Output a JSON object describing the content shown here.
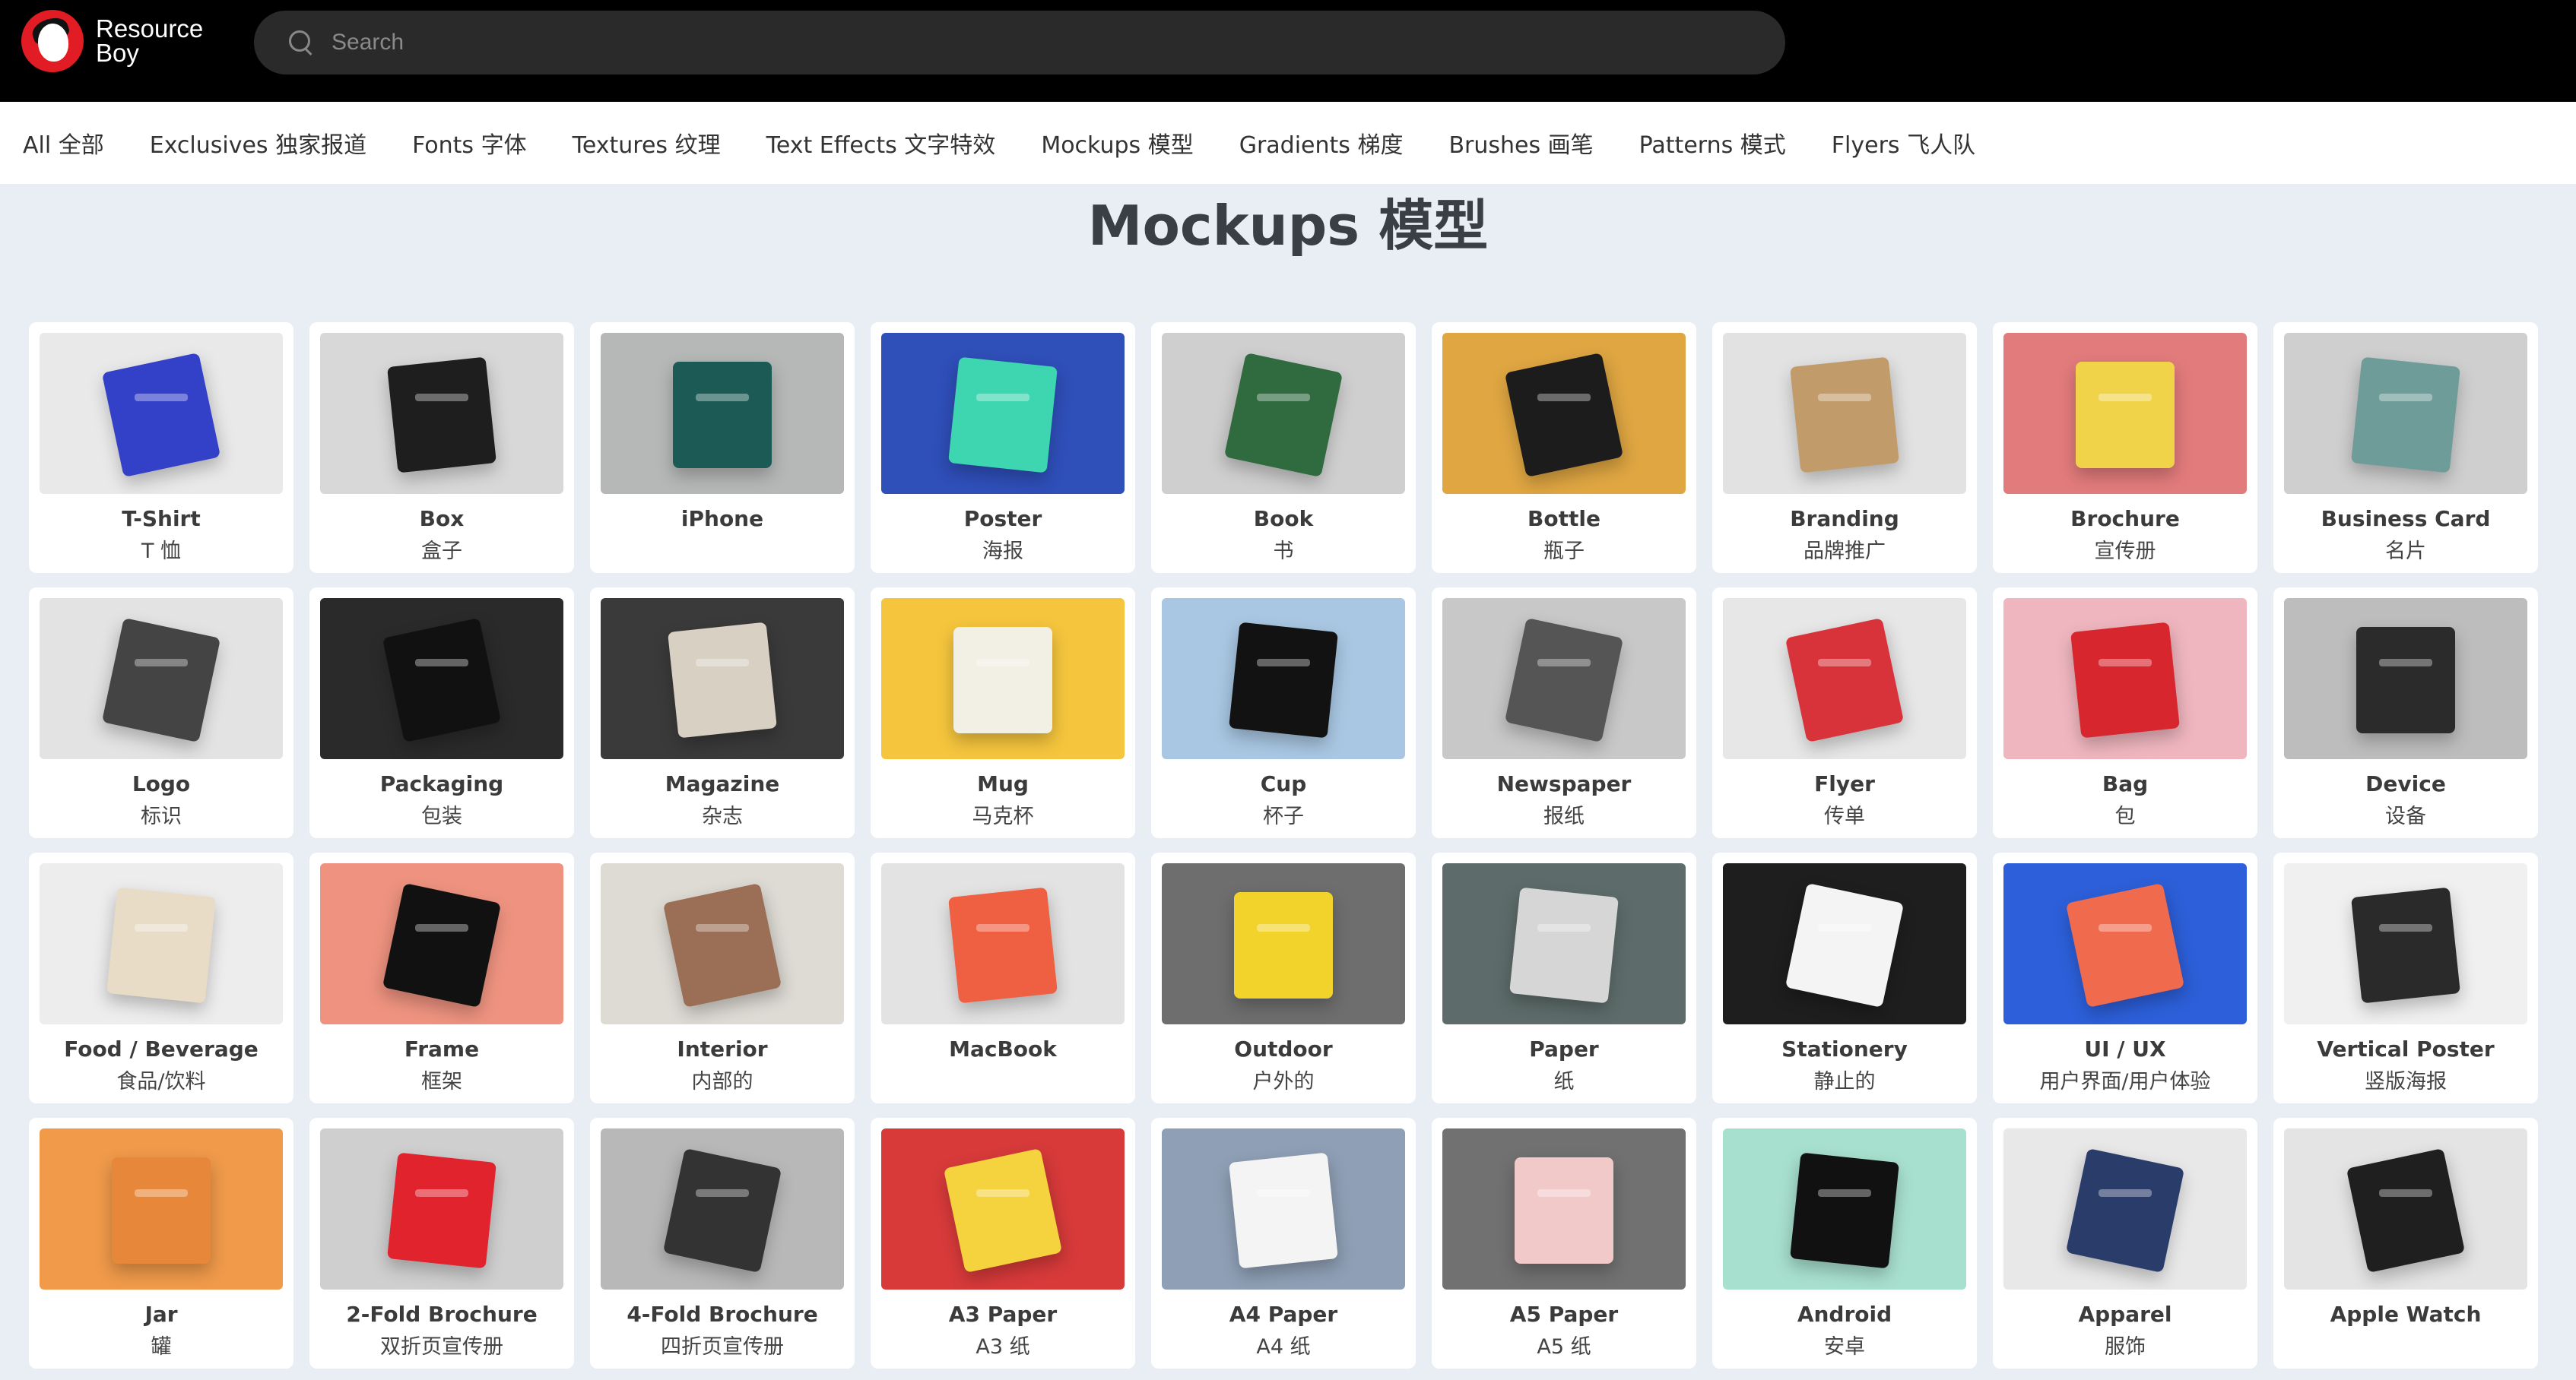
{
  "header": {
    "logo_line1": "Resource",
    "logo_line2": "Boy",
    "search_placeholder": "Search"
  },
  "nav": [
    "All  全部",
    "Exclusives  独家报道",
    "Fonts  字体",
    "Textures  纹理",
    "Text Effects  文字特效",
    "Mockups  模型",
    "Gradients  梯度",
    "Brushes  画笔",
    "Patterns  模式",
    "Flyers  飞人队"
  ],
  "page_title": "Mockups  模型",
  "cards": [
    {
      "en": "T-Shirt",
      "zh": "T 恤",
      "bg": "#e9e9e9",
      "accent": "#3340c8"
    },
    {
      "en": "Box",
      "zh": "盒子",
      "bg": "#d8d8d8",
      "accent": "#1e1e1e"
    },
    {
      "en": "iPhone",
      "zh": "",
      "bg": "#b6b8b7",
      "accent": "#1c5a55"
    },
    {
      "en": "Poster",
      "zh": "海报",
      "bg": "#2f4fb9",
      "accent": "#3dd6b0"
    },
    {
      "en": "Book",
      "zh": "书",
      "bg": "#cfcfcf",
      "accent": "#2f6b3f"
    },
    {
      "en": "Bottle",
      "zh": "瓶子",
      "bg": "#dfa642",
      "accent": "#1c1c1c"
    },
    {
      "en": "Branding",
      "zh": "品牌推广",
      "bg": "#e2e2e2",
      "accent": "#c29b6b"
    },
    {
      "en": "Brochure",
      "zh": "宣传册",
      "bg": "#e27b7c",
      "accent": "#f1d34a"
    },
    {
      "en": "Business Card",
      "zh": "名片",
      "bg": "#cfcfcf",
      "accent": "#6e9c99"
    },
    {
      "en": "Logo",
      "zh": "标识",
      "bg": "#e3e3e3",
      "accent": "#444444"
    },
    {
      "en": "Packaging",
      "zh": "包装",
      "bg": "#2a2a2a",
      "accent": "#111111"
    },
    {
      "en": "Magazine",
      "zh": "杂志",
      "bg": "#3a3a3a",
      "accent": "#d8d0c2"
    },
    {
      "en": "Mug",
      "zh": "马克杯",
      "bg": "#f5c53d",
      "accent": "#f2efe4"
    },
    {
      "en": "Cup",
      "zh": "杯子",
      "bg": "#a9c7e3",
      "accent": "#121212"
    },
    {
      "en": "Newspaper",
      "zh": "报纸",
      "bg": "#c8c8c8",
      "accent": "#555555"
    },
    {
      "en": "Flyer",
      "zh": "传单",
      "bg": "#e7e7e7",
      "accent": "#d8333a"
    },
    {
      "en": "Bag",
      "zh": "包",
      "bg": "#f0b6bf",
      "accent": "#d8262e"
    },
    {
      "en": "Device",
      "zh": "设备",
      "bg": "#bdbdbd",
      "accent": "#2b2b2b"
    },
    {
      "en": "Food / Beverage",
      "zh": "食品/饮料",
      "bg": "#ededed",
      "accent": "#e8dcc6"
    },
    {
      "en": "Frame",
      "zh": "框架",
      "bg": "#ef9380",
      "accent": "#111111"
    },
    {
      "en": "Interior",
      "zh": "内部的",
      "bg": "#dedad4",
      "accent": "#9a6f55"
    },
    {
      "en": "MacBook",
      "zh": "",
      "bg": "#e3e3e3",
      "accent": "#ef5f41"
    },
    {
      "en": "Outdoor",
      "zh": "户外的",
      "bg": "#6e6e6e",
      "accent": "#f2d32c"
    },
    {
      "en": "Paper",
      "zh": "纸",
      "bg": "#5d6c6a",
      "accent": "#d6d6d6"
    },
    {
      "en": "Stationery",
      "zh": "静止的",
      "bg": "#1e1e1e",
      "accent": "#f4f4f4"
    },
    {
      "en": "UI / UX",
      "zh": "用户界面/用户体验",
      "bg": "#2c5fd9",
      "accent": "#f06a4d"
    },
    {
      "en": "Vertical Poster",
      "zh": "竖版海报",
      "bg": "#f0f0f0",
      "accent": "#2a2a2a"
    },
    {
      "en": "Jar",
      "zh": "罐",
      "bg": "#f09a4a",
      "accent": "#e6873a"
    },
    {
      "en": "2-Fold Brochure",
      "zh": "双折页宣传册",
      "bg": "#cfcfcf",
      "accent": "#e0232d"
    },
    {
      "en": "4-Fold Brochure",
      "zh": "四折页宣传册",
      "bg": "#b8b8b8",
      "accent": "#333333"
    },
    {
      "en": "A3 Paper",
      "zh": "A3 纸",
      "bg": "#d83a3a",
      "accent": "#f4d33e"
    },
    {
      "en": "A4 Paper",
      "zh": "A4 纸",
      "bg": "#8f9fb5",
      "accent": "#f4f4f4"
    },
    {
      "en": "A5 Paper",
      "zh": "A5 纸",
      "bg": "#717171",
      "accent": "#f1c9c9"
    },
    {
      "en": "Android",
      "zh": "安卓",
      "bg": "#a8e0cf",
      "accent": "#111111"
    },
    {
      "en": "Apparel",
      "zh": "服饰",
      "bg": "#e8e8e8",
      "accent": "#2a3c6a"
    },
    {
      "en": "Apple Watch",
      "zh": "",
      "bg": "#e4e4e4",
      "accent": "#1f1f1f"
    }
  ]
}
